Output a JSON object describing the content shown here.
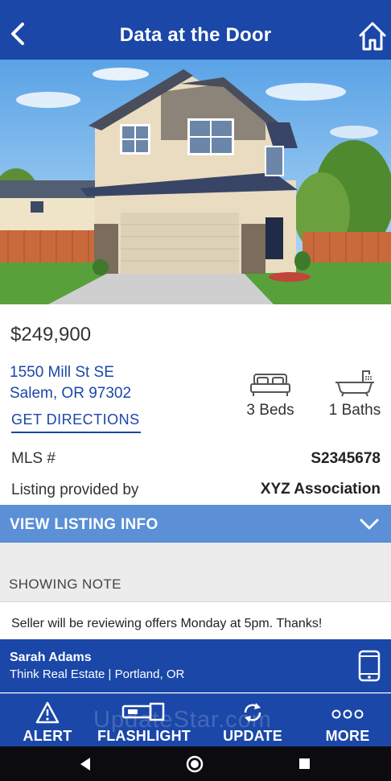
{
  "header": {
    "title": "Data at the Door"
  },
  "listing": {
    "price": "$249,900",
    "address_line1": "1550 Mill St SE",
    "address_line2": "Salem, OR 97302",
    "directions_label": "GET DIRECTIONS",
    "beds_label": "3 Beds",
    "baths_label": "1 Baths",
    "mls_label": "MLS #",
    "mls_value": "S2345678",
    "provider_label": "Listing provided by",
    "provider_value": "XYZ Association"
  },
  "view_listing": {
    "label": "VIEW LISTING INFO"
  },
  "showing": {
    "title": "SHOWING NOTE",
    "note": "Seller will be reviewing offers Monday at 5pm. Thanks!"
  },
  "agent": {
    "name": "Sarah Adams",
    "company": "Think Real Estate | Portland, OR"
  },
  "toolbar": {
    "alert_label": "ALERT",
    "flashlight_label": "FLASHLIGHT",
    "update_label": "UPDATE",
    "more_label": "MORE"
  },
  "watermark": "UpdateStar.com",
  "colors": {
    "primary": "#1a47a8",
    "accent_bar": "#5b8fd6",
    "note_background": "#ececec"
  },
  "icons": [
    "back-arrow-icon",
    "home-icon",
    "bed-icon",
    "bathtub-icon",
    "chevron-down-icon",
    "phone-icon",
    "alert-icon",
    "flashlight-icon",
    "update-icon",
    "more-icon",
    "nav-back-icon",
    "nav-home-icon",
    "nav-recents-icon"
  ]
}
